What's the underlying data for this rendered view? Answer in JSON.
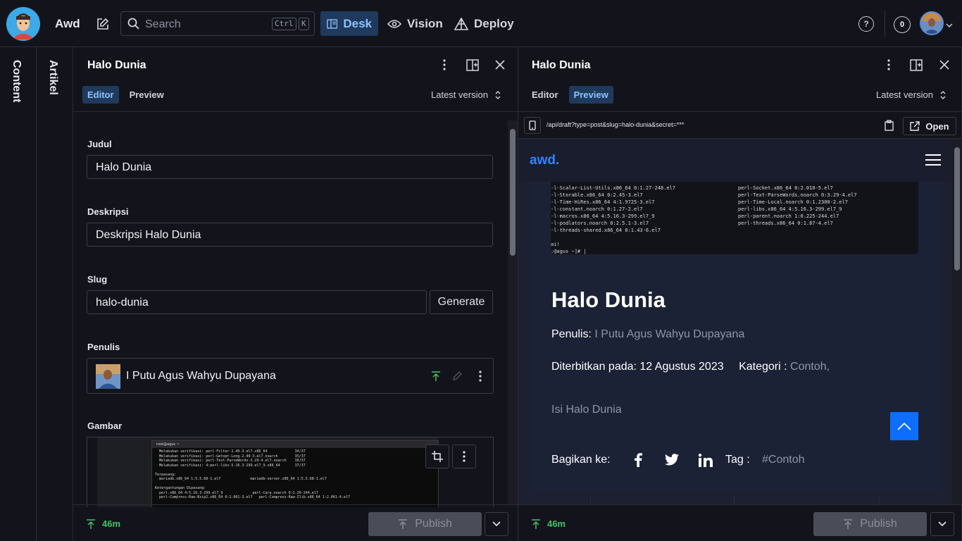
{
  "topbar": {
    "brand": "Awd",
    "search_placeholder": "Search",
    "shortcut_ctrl": "Ctrl",
    "shortcut_k": "K",
    "tabs": [
      "Desk",
      "Vision",
      "Deploy"
    ],
    "active_tab": "Desk",
    "counter": "0"
  },
  "sidebar": {
    "strip1": "Content",
    "strip2": "Artikel"
  },
  "editor": {
    "title": "Halo Dunia",
    "tabs": [
      "Editor",
      "Preview"
    ],
    "active_tab": "Editor",
    "version": "Latest version",
    "fields": {
      "judul_label": "Judul",
      "judul_value": "Halo Dunia",
      "deskripsi_label": "Deskripsi",
      "deskripsi_value": "Deskripsi Halo Dunia",
      "slug_label": "Slug",
      "slug_value": "halo-dunia",
      "generate_label": "Generate",
      "penulis_label": "Penulis",
      "penulis_value": "I Putu Agus Wahyu Dupayana",
      "gambar_label": "Gambar"
    },
    "footer": {
      "ago": "46m",
      "publish": "Publish"
    }
  },
  "preview": {
    "title": "Halo Dunia",
    "tabs": [
      "Editor",
      "Preview"
    ],
    "active_tab": "Preview",
    "version": "Latest version",
    "url": "/api/draft?type=post&slug=halo-dunia&secret=***",
    "open_label": "Open",
    "site": {
      "logo": "awd.",
      "post_title": "Halo Dunia",
      "penulis_label": "Penulis:",
      "penulis_value": "I Putu Agus Wahyu Dupayana",
      "published_label": "Diterbitkan pada: 12 Agustus 2023",
      "kategori_label": "Kategori :",
      "kategori_value": "Contoh,",
      "body": "Isi Halo Dunia",
      "share_label": "Bagikan ke:",
      "tag_label": "Tag :",
      "tag_value": "#Contoh"
    },
    "footer": {
      "ago": "46m",
      "publish": "Publish"
    }
  },
  "terminal_left": [
    "-l-Scalar-List-Utils.x86_64 0:1.27-248.el7",
    "-l-Storable.x86_64 0:2.45-3.el7",
    "-l-Time-HiRes.x86_64 4:1.9725-3.el7",
    "-l-constant.noarch 0:1.27-2.el7",
    "-l-macros.x86_64 4:5.16.3-299.el7_9",
    "-l-podlators.noarch 0:2.5.1-3.el7",
    "-l-threads-shared.x86_64 0:1.43-6.el7",
    "",
    "ai!",
    ":@agus ~]# |"
  ],
  "terminal_right": [
    "perl-Socket.x86_64 0:2.010-5.el7",
    "perl-Text-ParseWords.noarch 0:3.29-4.el7",
    "perl-Time-Local.noarch 0:1.2300-2.el7",
    "perl-libs.x86_64 4:5.16.3-299.el7_9",
    "perl-parent.noarch 1:0.225-244.el7",
    "perl-threads.x86_64 0:1.87-4.el7"
  ],
  "image_terminal": [
    "  Melakukan verifikasi: perl-Filter-1.49-3.el7.x86_64             34/37",
    "  Melakukan verifikasi: perl-Getopt-Long-2.40-3.el7.noarch        35/37",
    "  Melakukan verifikasi: perl-Text-ParseWords-3.29-4.el7.noarch    36/37",
    "  Melakukan verifikasi: 4:perl-libs-5.16.3-299.el7_9.x86_64       37/37",
    "",
    "Terpasang:",
    "  mariadb.x86_64 1:5.5.68-1.el7              mariadb-server.x86_64 1:5.5.68-1.el7",
    "",
    "Ketergantungan Dipasang:",
    "  perl.x86_64 4:5.16.3-299.el7_9              perl-Carp.noarch 0:1.26-244.el7",
    "  perl-Compress-Raw-Bzip2.x86_64 0:2.061-3.el7   perl-Compress-Raw-Zlib.x86_64 1:2.061-4.el7"
  ],
  "colors": {
    "accent": "#8ec4ff",
    "active_bg": "#1f3a5c",
    "success": "#43c463",
    "site_blue": "#0d6efd"
  }
}
